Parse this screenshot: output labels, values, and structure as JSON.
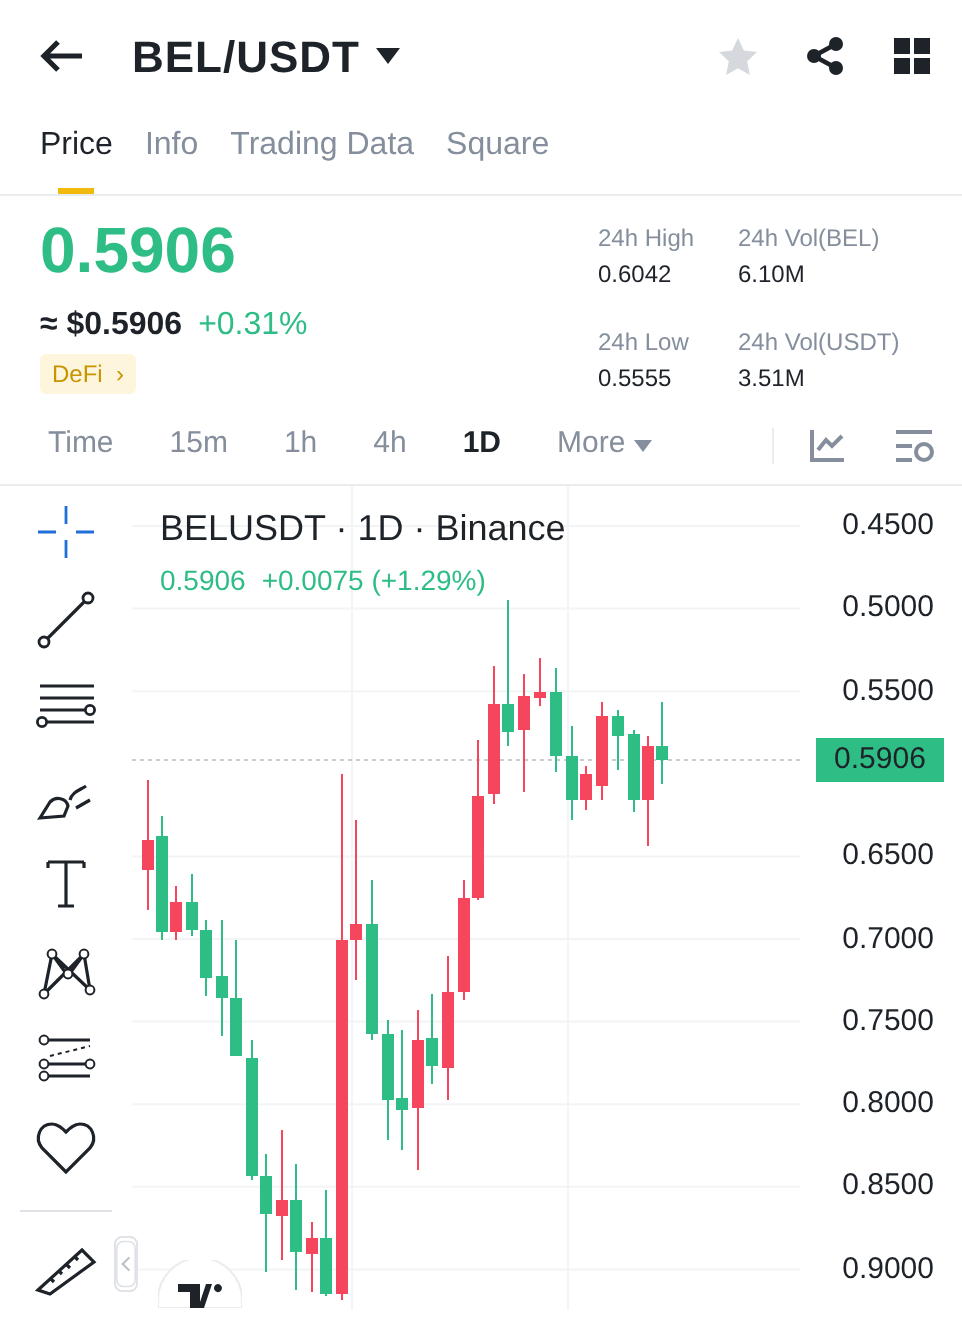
{
  "header": {
    "title": "BEL/USDT"
  },
  "tabs": [
    {
      "label": "Price",
      "selected": true
    },
    {
      "label": "Info",
      "selected": false
    },
    {
      "label": "Trading Data",
      "selected": false
    },
    {
      "label": "Square",
      "selected": false
    }
  ],
  "ticker": {
    "price": "0.5906",
    "usd_price": "≈ $0.5906",
    "change": "+0.31%",
    "tag": "DeFi",
    "tag_arrow": "›"
  },
  "stats": [
    {
      "label": "24h High",
      "value": "0.6042"
    },
    {
      "label": "24h Vol(BEL)",
      "value": "6.10M"
    },
    {
      "label": "24h Low",
      "value": "0.5555"
    },
    {
      "label": "24h Vol(USDT)",
      "value": "3.51M"
    }
  ],
  "intervals": [
    {
      "label": "Time",
      "selected": false,
      "kind": "interval"
    },
    {
      "label": "15m",
      "selected": false,
      "kind": "interval"
    },
    {
      "label": "1h",
      "selected": false,
      "kind": "interval"
    },
    {
      "label": "4h",
      "selected": false,
      "kind": "interval"
    },
    {
      "label": "1D",
      "selected": true,
      "kind": "interval"
    },
    {
      "label": "More",
      "selected": false,
      "kind": "menu"
    }
  ],
  "chart": {
    "legend": "BELUSDT · 1D · Binance",
    "last_price": "0.5906",
    "change": "+0.0075 (+1.29%)",
    "price_tag": "0.5906",
    "axis_labels": [
      "0.4500",
      "0.5000",
      "0.5500",
      "0.6500",
      "0.7000",
      "0.7500",
      "0.8000",
      "0.8500",
      "0.9000"
    ]
  }
}
